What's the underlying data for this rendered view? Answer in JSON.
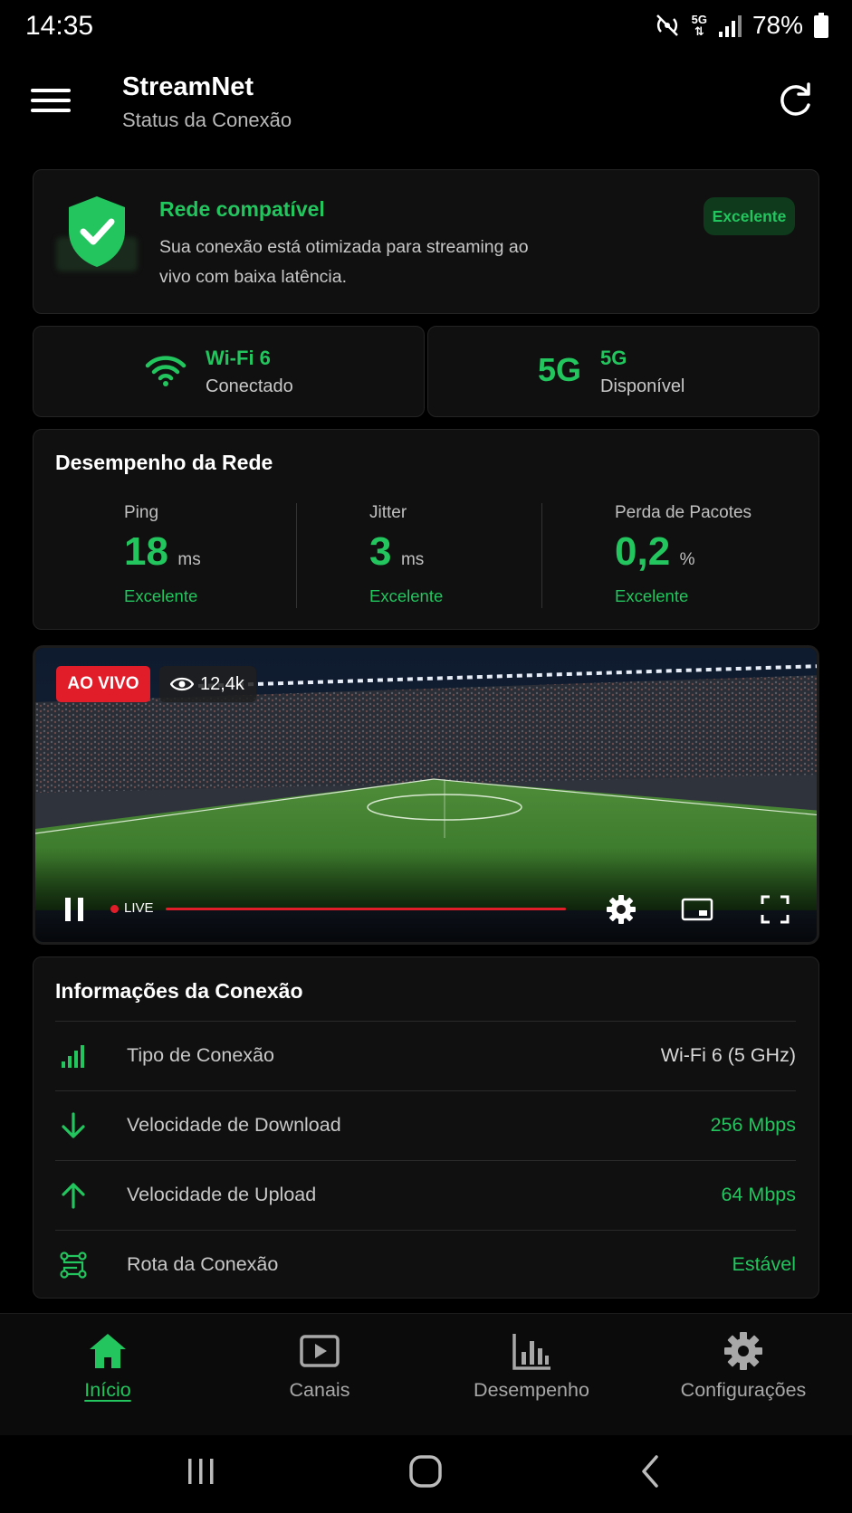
{
  "status_bar": {
    "time": "14:35",
    "network": "5G",
    "battery": "78%"
  },
  "header": {
    "title": "StreamNet",
    "subtitle": "Status da Conexão"
  },
  "compat": {
    "title": "Rede compatível",
    "description": "Sua conexão está otimizada para streaming ao vivo com baixa latência.",
    "badge": "Excelente"
  },
  "connections": {
    "wifi": {
      "title": "Wi-Fi 6",
      "status": "Conectado"
    },
    "cellular": {
      "big": "5G",
      "title": "5G",
      "status": "Disponível"
    }
  },
  "performance": {
    "title": "Desempenho da Rede",
    "metrics": [
      {
        "label": "Ping",
        "value": "18",
        "unit": "ms",
        "quality": "Excelente"
      },
      {
        "label": "Jitter",
        "value": "3",
        "unit": "ms",
        "quality": "Excelente"
      },
      {
        "label": "Perda de Pacotes",
        "value": "0,2",
        "unit": "%",
        "quality": "Excelente"
      }
    ]
  },
  "video": {
    "live_badge": "AO VIVO",
    "viewers": "12,4k",
    "live_label": "LIVE"
  },
  "info": {
    "title": "Informações da Conexão",
    "rows": [
      {
        "label": "Tipo de Conexão",
        "value": "Wi-Fi 6 (5 GHz)"
      },
      {
        "label": "Velocidade de Download",
        "value": "256 Mbps"
      },
      {
        "label": "Velocidade de Upload",
        "value": "64 Mbps"
      },
      {
        "label": "Rota da Conexão",
        "value": "Estável"
      }
    ]
  },
  "nav": {
    "items": [
      {
        "label": "Início",
        "icon": "home-icon",
        "active": true
      },
      {
        "label": "Canais",
        "icon": "play-icon"
      },
      {
        "label": "Desempenho",
        "icon": "chart-icon"
      },
      {
        "label": "Configurações",
        "icon": "gear-icon"
      }
    ]
  },
  "colors": {
    "accent": "#22c55e",
    "live": "#e11d2a",
    "background": "#000000",
    "card": "#101010"
  }
}
